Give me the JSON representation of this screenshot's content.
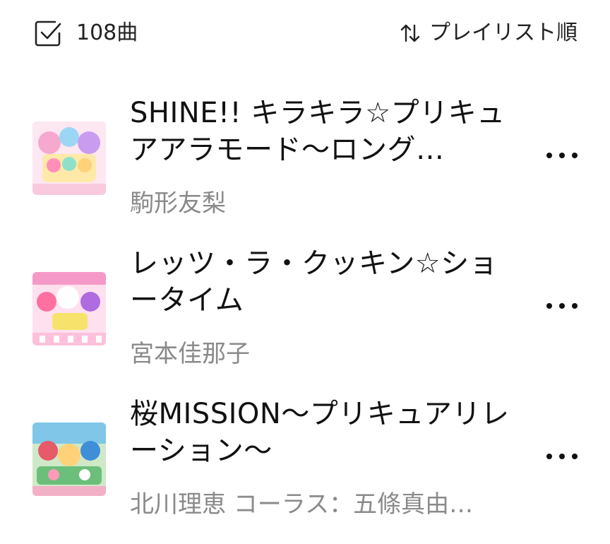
{
  "header": {
    "count_label": "108曲",
    "sort_label": "プレイリスト順",
    "select_icon": "checkbox-icon",
    "sort_icon": "sort-arrows-icon"
  },
  "tracks": [
    {
      "title": "SHINE!! キラキラ☆プリキュアアラモード〜ロング…",
      "artist": "駒形友梨",
      "art_colors": [
        "#f7c8e0",
        "#9bd7f5",
        "#ffe27a",
        "#ff8fb8"
      ]
    },
    {
      "title": "レッツ・ラ・クッキン☆ショータイム",
      "artist": "宮本佳那子",
      "art_colors": [
        "#f59ac8",
        "#ffd0e4",
        "#f7e36b",
        "#b06be0"
      ]
    },
    {
      "title": "桜MISSION〜プリキュアリレーション〜",
      "artist": "北川理恵 コーラス：五條真由…",
      "art_colors": [
        "#6cbf7a",
        "#e65a6a",
        "#ffd27a",
        "#3e8fd8"
      ]
    }
  ],
  "more_icon": "more-horizontal-icon"
}
